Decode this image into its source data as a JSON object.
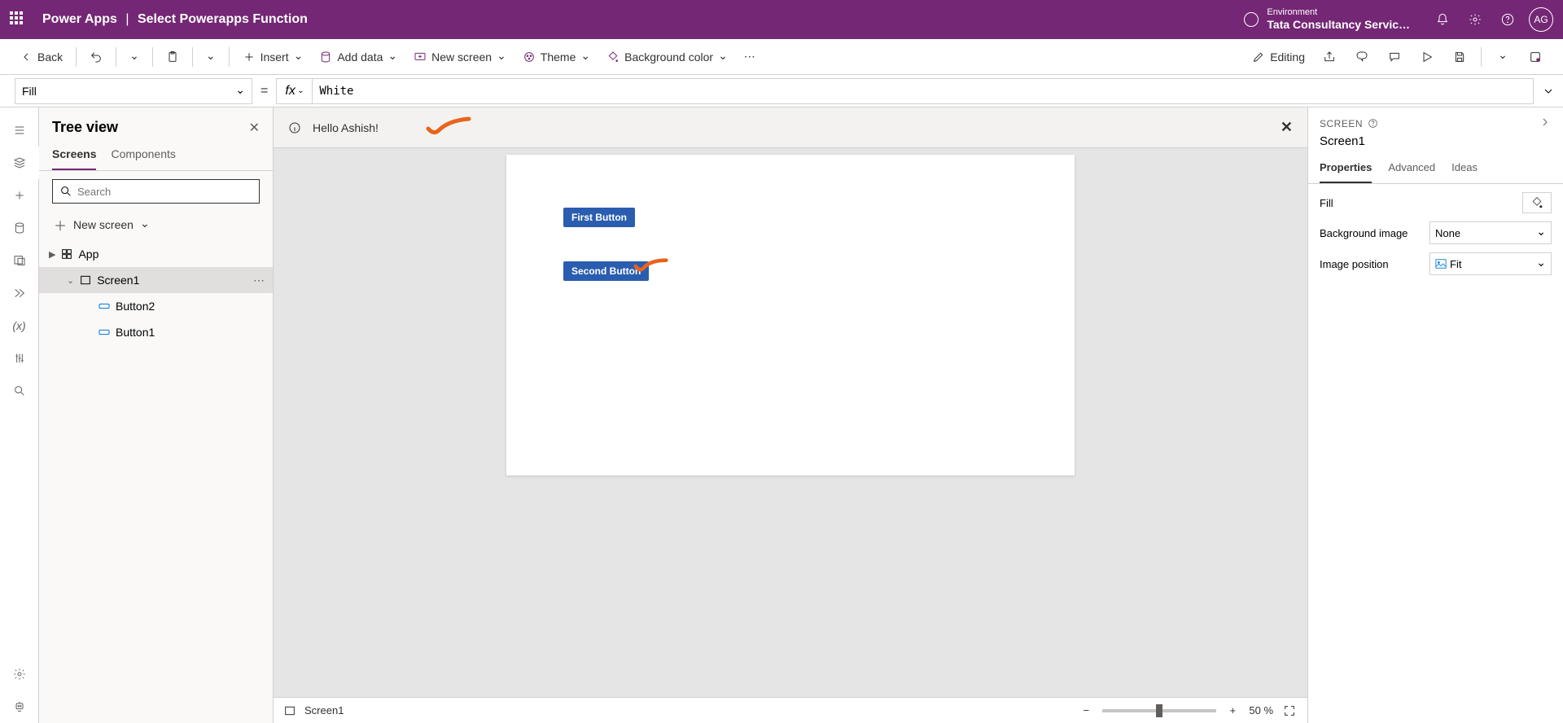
{
  "header": {
    "app_name": "Power Apps",
    "separator": "|",
    "page_title": "Select Powerapps Function",
    "env_label": "Environment",
    "env_value": "Tata Consultancy Servic…",
    "avatar_initials": "AG"
  },
  "commandbar": {
    "back": "Back",
    "insert": "Insert",
    "add_data": "Add data",
    "new_screen": "New screen",
    "theme": "Theme",
    "bg_color": "Background color",
    "editing": "Editing"
  },
  "formula": {
    "property": "Fill",
    "value": "White"
  },
  "tree": {
    "title": "Tree view",
    "tab_screens": "Screens",
    "tab_components": "Components",
    "search_placeholder": "Search",
    "new_screen": "New screen",
    "app_node": "App",
    "screen1": "Screen1",
    "button2": "Button2",
    "button1": "Button1"
  },
  "banner": {
    "message": "Hello Ashish!"
  },
  "canvas": {
    "button1_label": "First Button",
    "button2_label": "Second Button"
  },
  "footer": {
    "screen_name": "Screen1",
    "zoom_value": "50",
    "zoom_unit": "%"
  },
  "properties": {
    "header": "SCREEN",
    "name": "Screen1",
    "tab_properties": "Properties",
    "tab_advanced": "Advanced",
    "tab_ideas": "Ideas",
    "fill_label": "Fill",
    "bg_image_label": "Background image",
    "bg_image_value": "None",
    "img_pos_label": "Image position",
    "img_pos_value": "Fit"
  }
}
